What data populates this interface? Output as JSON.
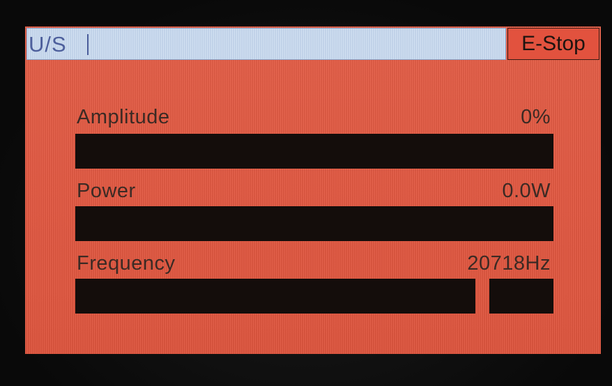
{
  "header": {
    "mode_label": "U/S",
    "estop_label": "E-Stop"
  },
  "readouts": [
    {
      "name": "amplitude",
      "label": "Amplitude",
      "value": "0%",
      "level": 0
    },
    {
      "name": "power",
      "label": "Power",
      "value": "0.0W",
      "level": 0
    },
    {
      "name": "frequency",
      "label": "Frequency",
      "value": "20718Hz",
      "level": 0
    }
  ],
  "colors": {
    "screen_bg": "#e45c45",
    "title_bar_bg": "#c7d9ef",
    "bar_bg": "#140d0b",
    "text": "#3b2a24"
  }
}
